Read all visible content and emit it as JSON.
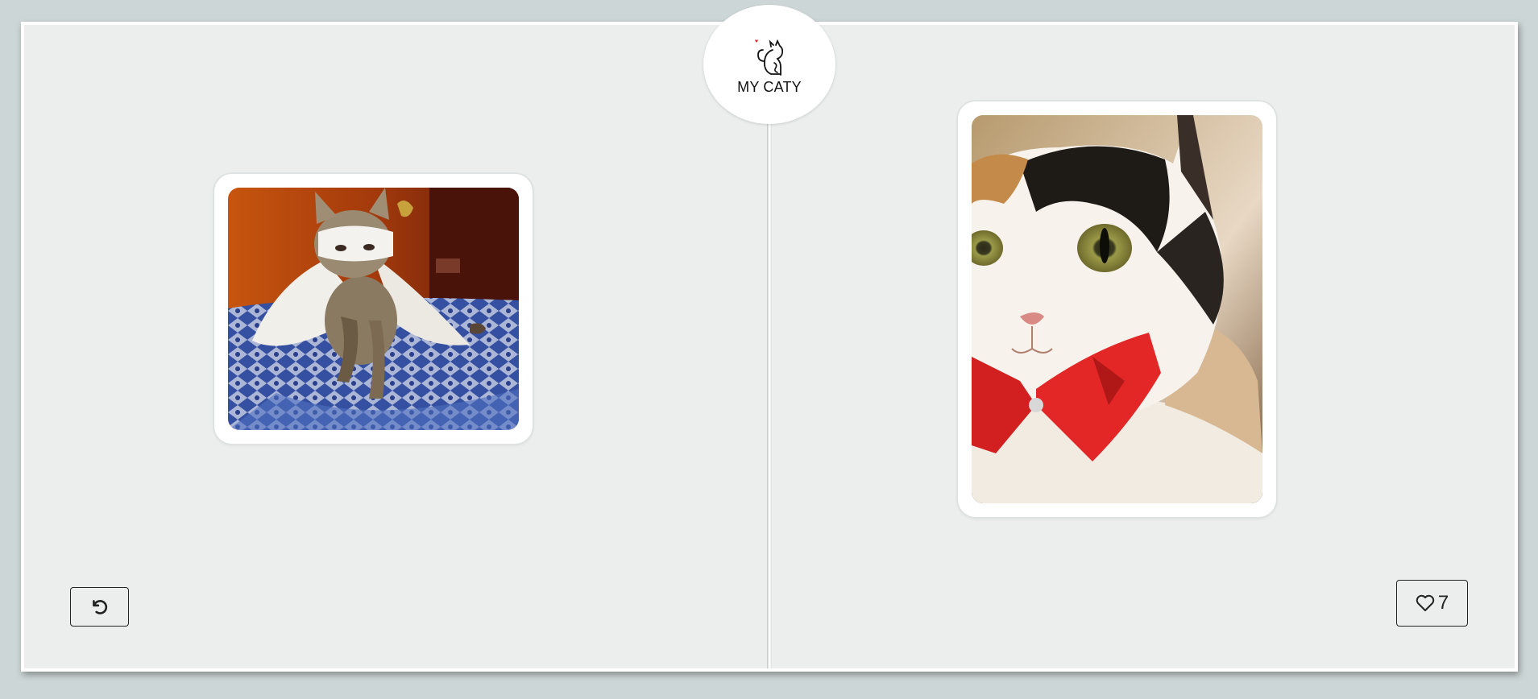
{
  "app": {
    "logo_text": "MY CATY"
  },
  "cards": [
    {
      "name": "cat-photo-left",
      "icon": "cat-in-mask-and-cape-photo"
    },
    {
      "name": "cat-photo-right",
      "icon": "calico-cat-with-red-bow-photo"
    }
  ],
  "controls": {
    "undo_icon": "undo-icon",
    "like_icon": "heart-icon",
    "like_count": "7"
  },
  "colors": {
    "board": "#eceded",
    "background": "#cdd6d6",
    "logo_heart": "#e0242c"
  }
}
